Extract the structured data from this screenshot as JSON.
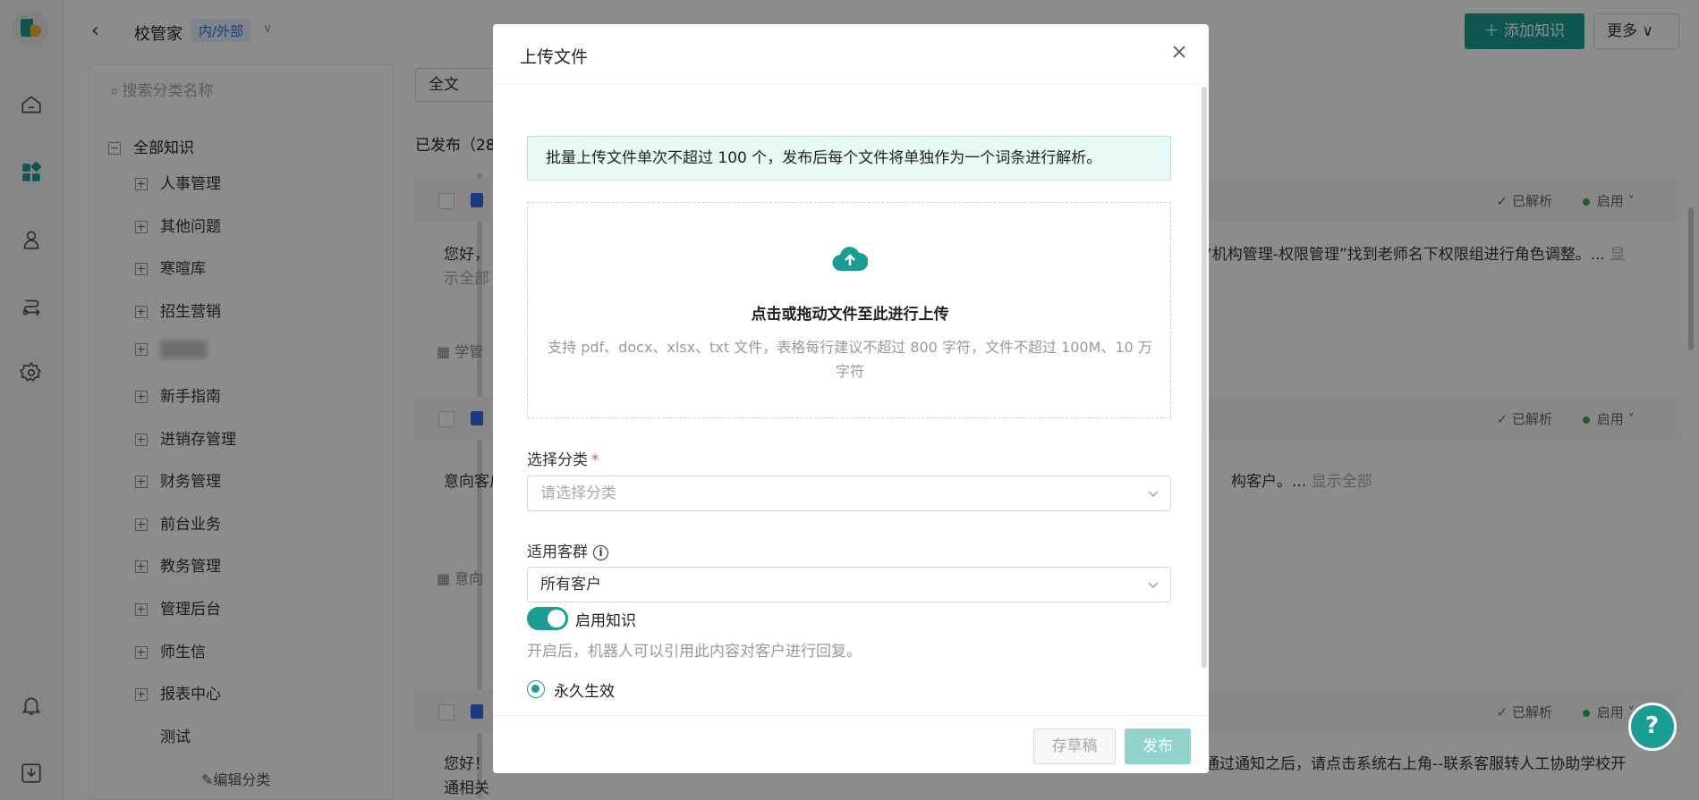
{
  "header": {
    "back_icon": "chevron-left-icon",
    "title": "校管家",
    "scope_tag": "内/外部",
    "add_button": "添加知识",
    "more_button": "更多"
  },
  "categories": {
    "search_placeholder": "搜索分类名称",
    "root": "全部知识",
    "items": [
      "人事管理",
      "其他问题",
      "寒暄库",
      "招生营销",
      "",
      "新手指南",
      "进销存管理",
      "财务管理",
      "前台业务",
      "教务管理",
      "管理后台",
      "师生信",
      "报表中心"
    ],
    "leaf": "测试",
    "edit": "编辑分类"
  },
  "main": {
    "filter": "全文",
    "published_prefix": "已发布（28",
    "parsed_label": "已解析",
    "enabled_label": "启用",
    "cards": [
      {
        "body_left": "您好，",
        "body_right": "“机构管理-权限管理”找到老师名下权限组进行角色调整。...",
        "more": "显",
        "more2": "示全部",
        "foot": "学管"
      },
      {
        "body_left": "意向客户",
        "body_right": "构客户。...",
        "more": "显示全部",
        "more2": "",
        "foot": "意向"
      },
      {
        "body_left": "您好！",
        "body_right": "通过通知之后，请点击系统右上角--联系客服转人工协助学校开",
        "more": "",
        "more2": "通相关",
        "foot": ""
      }
    ]
  },
  "modal": {
    "title": "上传文件",
    "notice": "批量上传文件单次不超过 100 个，发布后每个文件将单独作为一个词条进行解析。",
    "drop_title": "点击或拖动文件至此进行上传",
    "drop_hint": "支持 pdf、docx、xlsx、txt 文件，表格每行建议不超过 800 字符，文件不超过 100M、10 万字符",
    "category_label": "选择分类",
    "category_required": "*",
    "category_placeholder": "请选择分类",
    "audience_label": "适用客群",
    "audience_value": "所有客户",
    "toggle_label": "启用知识",
    "toggle_on": true,
    "toggle_desc": "开启后，机器人可以引用此内容对客户进行回复。",
    "radio_label": "永久生效",
    "draft_button": "存草稿",
    "publish_button": "发布"
  },
  "colors": {
    "accent": "#1a9e93",
    "overlay": "rgba(0,0,0,0.45)"
  }
}
